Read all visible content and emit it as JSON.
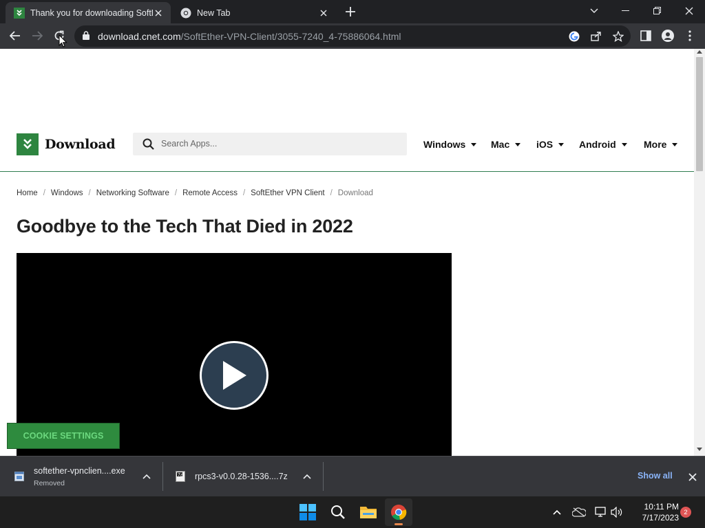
{
  "browser": {
    "tabs": [
      {
        "title": "Thank you for downloading SoftEther",
        "active": true,
        "favicon": "cnet-download-favicon"
      },
      {
        "title": "New Tab",
        "active": false,
        "favicon": "chrome-favicon"
      }
    ],
    "address": {
      "host": "download.cnet.com",
      "path": "/SoftEther-VPN-Client/3055-7240_4-75886064.html"
    }
  },
  "site": {
    "logo_text": "Download",
    "search_placeholder": "Search Apps...",
    "nav": [
      "Windows",
      "Mac",
      "iOS",
      "Android",
      "More"
    ],
    "breadcrumb": [
      "Home",
      "Windows",
      "Networking Software",
      "Remote Access",
      "SoftEther VPN Client",
      "Download"
    ],
    "headline": "Goodbye to the Tech That Died in 2022",
    "cookie_button": "COOKIE SETTINGS"
  },
  "downloads": {
    "items": [
      {
        "name": "softether-vpnclien....exe",
        "status": "Removed"
      },
      {
        "name": "rpcs3-v0.0.28-1536....7z",
        "status": ""
      }
    ],
    "show_all": "Show all"
  },
  "taskbar": {
    "time": "10:11 PM",
    "date": "7/17/2023",
    "notifications": "2"
  },
  "colors": {
    "brand_green": "#2e8540",
    "chrome_dark": "#202124",
    "chrome_toolbar": "#35363a",
    "link_blue": "#8ab4f8"
  }
}
